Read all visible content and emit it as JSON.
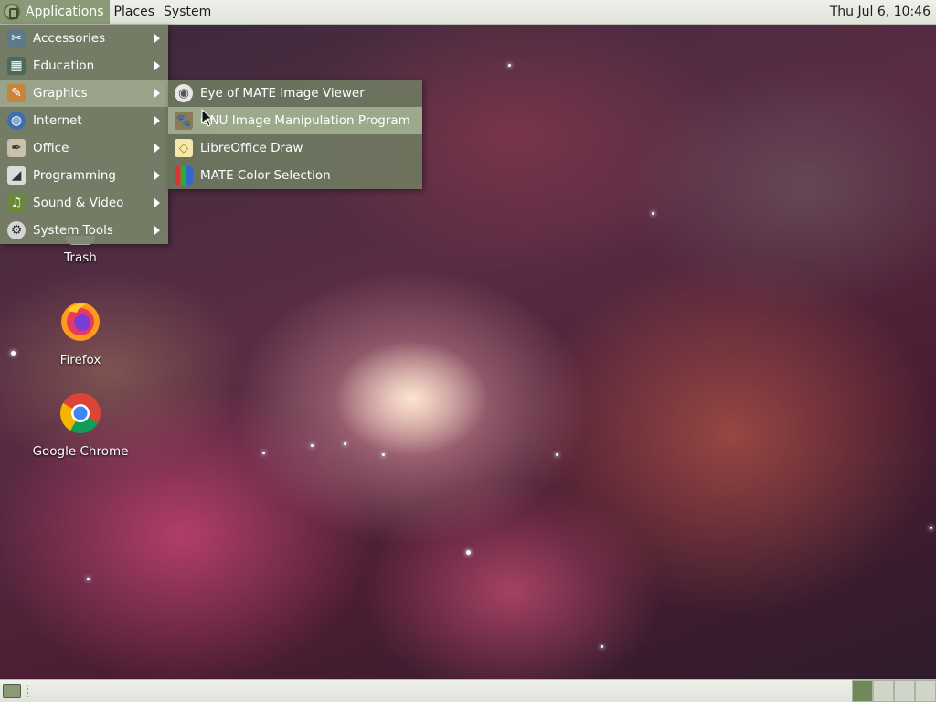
{
  "top_panel": {
    "applications_label": "Applications",
    "places_label": "Places",
    "system_label": "System",
    "clock": "Thu Jul  6, 10:46"
  },
  "app_menu": {
    "items": [
      {
        "label": "Accessories",
        "icon": "accessories-icon"
      },
      {
        "label": "Education",
        "icon": "education-icon"
      },
      {
        "label": "Graphics",
        "icon": "graphics-icon",
        "active": true
      },
      {
        "label": "Internet",
        "icon": "internet-icon"
      },
      {
        "label": "Office",
        "icon": "office-icon"
      },
      {
        "label": "Programming",
        "icon": "programming-icon"
      },
      {
        "label": "Sound & Video",
        "icon": "sound-video-icon"
      },
      {
        "label": "System Tools",
        "icon": "system-tools-icon"
      }
    ]
  },
  "graphics_submenu": {
    "items": [
      {
        "label": "Eye of MATE Image Viewer",
        "icon": "eye-of-mate-icon"
      },
      {
        "label": "GNU Image Manipulation Program",
        "icon": "gimp-icon",
        "hover": true
      },
      {
        "label": "LibreOffice Draw",
        "icon": "libreoffice-draw-icon"
      },
      {
        "label": "MATE Color Selection",
        "icon": "color-selection-icon"
      }
    ]
  },
  "desktop_icons": {
    "trash": "Trash",
    "firefox": "Firefox",
    "chrome": "Google Chrome"
  },
  "colors": {
    "menu_bg": "#78826a",
    "panel_bg": "#e6e9e1",
    "accent": "#8a9a76"
  }
}
